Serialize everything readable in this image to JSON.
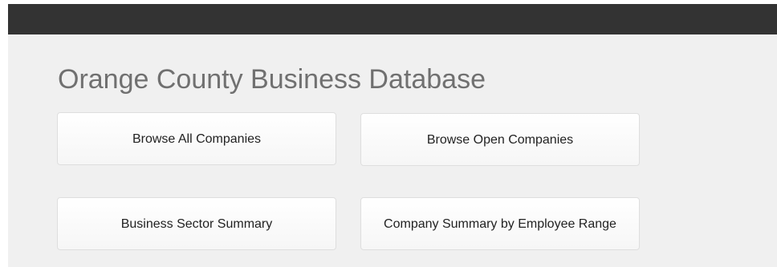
{
  "header": {
    "title": "Orange County Business Database"
  },
  "buttons": {
    "browse_all": "Browse All Companies",
    "browse_open": "Browse Open Companies",
    "sector_summary": "Business Sector Summary",
    "employee_range": "Company Summary by Employee Range"
  },
  "colors": {
    "top_bar": "#333333",
    "page_background": "#f0f0f0",
    "title_text": "#707070"
  }
}
